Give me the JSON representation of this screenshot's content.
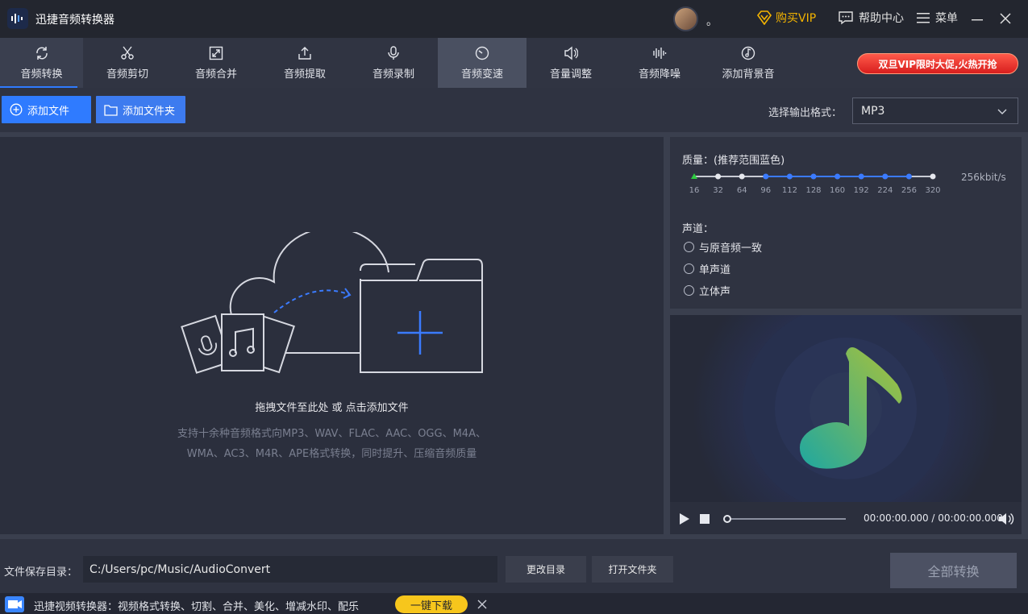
{
  "app": {
    "title": "迅捷音频转换器",
    "user_dot": "。"
  },
  "header": {
    "vip_label": "购买VIP",
    "help_label": "帮助中心",
    "menu_label": "菜单"
  },
  "tabs": [
    {
      "label": "音频转换",
      "icon": "refresh-icon"
    },
    {
      "label": "音频剪切",
      "icon": "scissors-icon"
    },
    {
      "label": "音频合并",
      "icon": "merge-icon"
    },
    {
      "label": "音频提取",
      "icon": "extract-icon"
    },
    {
      "label": "音频录制",
      "icon": "microphone-icon"
    },
    {
      "label": "音频变速",
      "icon": "speed-icon"
    },
    {
      "label": "音量调整",
      "icon": "volume-icon"
    },
    {
      "label": "音频降噪",
      "icon": "denoise-icon"
    },
    {
      "label": "添加背景音",
      "icon": "music-disc-icon"
    }
  ],
  "promo": "双旦VIP限时大促,火热开抢",
  "actions": {
    "add_file": "添加文件",
    "add_folder": "添加文件夹",
    "format_label": "选择输出格式：",
    "format_value": "MP3"
  },
  "dropzone": {
    "title": "拖拽文件至此处 或 点击添加文件",
    "desc_line1": "支持十余种音频格式向MP3、WAV、FLAC、AAC、OGG、M4A、",
    "desc_line2": "WMA、AC3、M4R、APE格式转换，同时提升、压缩音频质量"
  },
  "quality": {
    "label": "质量：(推荐范围蓝色)",
    "value": "256kbit/s",
    "ticks": [
      "16",
      "32",
      "64",
      "96",
      "112",
      "128",
      "160",
      "192",
      "224",
      "256",
      "320"
    ],
    "selected": "256",
    "recommended": [
      "96",
      "112",
      "128",
      "160",
      "192",
      "224",
      "256"
    ]
  },
  "channel": {
    "label": "声道：",
    "options": [
      "与原音频一致",
      "单声道",
      "立体声"
    ]
  },
  "player": {
    "time": "00:00:00.000 / 00:00:00.000",
    "progress": 0
  },
  "save": {
    "label": "文件保存目录：",
    "path": "C:/Users/pc/Music/AudioConvert",
    "change_dir": "更改目录",
    "open_folder": "打开文件夹",
    "convert_all": "全部转换"
  },
  "ad": {
    "text": "迅捷视频转换器：视频格式转换、切割、合并、美化、增减水印、配乐",
    "button": "一键下载"
  },
  "colors": {
    "accent": "#2f7bff",
    "vip": "#f4b400",
    "promo": "#d81e1e",
    "ad_button": "#f7c61c"
  }
}
